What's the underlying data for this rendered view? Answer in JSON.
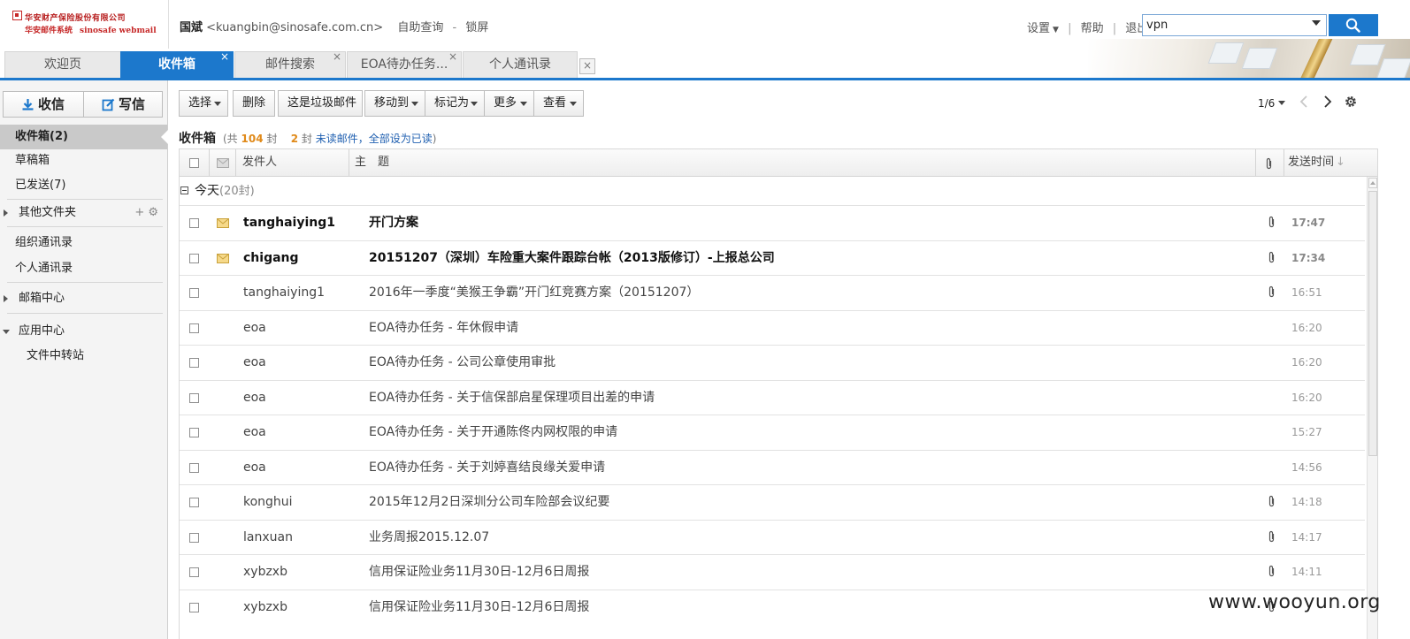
{
  "header": {
    "logo_cn": "华安财产保险股份有限公司",
    "logo_sub_cn": "华安邮件系统",
    "logo_sub_en": "sinosafe webmail",
    "user_name": "国斌",
    "user_email": "<kuangbin@sinosafe.com.cn>",
    "self_query": "自助查询",
    "separator": "-",
    "lock_screen": "锁屏",
    "settings": "设置",
    "help": "帮助",
    "logout": "退出",
    "link_sep": "|",
    "search_value": "vpn"
  },
  "tabs": [
    {
      "label": "欢迎页",
      "closable": false
    },
    {
      "label": "收件箱",
      "closable": true,
      "active": true
    },
    {
      "label": "邮件搜索",
      "closable": true
    },
    {
      "label": "EOA待办任务...",
      "closable": true
    },
    {
      "label": "个人通讯录",
      "closable": false
    }
  ],
  "tab_close_glyph": "×",
  "sidebar": {
    "receive_btn": "收信",
    "compose_btn": "写信",
    "items": [
      {
        "label": "收件箱(2)"
      },
      {
        "label": "草稿箱"
      },
      {
        "label": "已发送(7)"
      },
      {
        "label": "其他文件夹",
        "tools": "+ ⚙"
      },
      {
        "label": "组织通讯录"
      },
      {
        "label": "个人通讯录"
      },
      {
        "label": "邮箱中心"
      },
      {
        "label": "应用中心"
      },
      {
        "label": "文件中转站"
      }
    ]
  },
  "toolbar": {
    "select": "选择",
    "delete": "删除",
    "spam": "这是垃圾邮件",
    "move_to": "移动到",
    "mark_as": "标记为",
    "more": "更多",
    "view": "查看",
    "page_indicator": "1/6"
  },
  "folder": {
    "title": "收件箱",
    "total_prefix": "(共",
    "total_count": "104",
    "total_suffix": "封",
    "unread_count": "2",
    "unread_suffix": "封",
    "unread_link": "未读邮件",
    "mark_all_link": "，全部设为已读",
    "close_paren": ")"
  },
  "table": {
    "col_sender": "发件人",
    "col_subject": "主　题",
    "col_time": "发送时间",
    "sort_arrow": "↓",
    "group_label": "今天",
    "group_count": "(20封)",
    "rows": [
      {
        "sender": "tanghaiying1",
        "subject": "开门方案",
        "time": "17:47",
        "unread": true,
        "attach": true
      },
      {
        "sender": "chigang",
        "subject": "20151207（深圳）车险重大案件跟踪台帐（2013版修订）-上报总公司",
        "time": "17:34",
        "unread": true,
        "attach": true
      },
      {
        "sender": "tanghaiying1",
        "subject": "2016年一季度“美猴王争霸”开门红竞赛方案（20151207）",
        "time": "16:51",
        "unread": false,
        "attach": true
      },
      {
        "sender": "eoa",
        "subject": "EOA待办任务 - 年休假申请",
        "time": "16:20",
        "unread": false,
        "attach": false
      },
      {
        "sender": "eoa",
        "subject": "EOA待办任务 - 公司公章使用审批",
        "time": "16:20",
        "unread": false,
        "attach": false
      },
      {
        "sender": "eoa",
        "subject": "EOA待办任务 - 关于信保部启星保理项目出差的申请",
        "time": "16:20",
        "unread": false,
        "attach": false
      },
      {
        "sender": "eoa",
        "subject": "EOA待办任务 - 关于开通陈佟内网权限的申请",
        "time": "15:27",
        "unread": false,
        "attach": false
      },
      {
        "sender": "eoa",
        "subject": "EOA待办任务 - 关于刘婷喜结良缘关爱申请",
        "time": "14:56",
        "unread": false,
        "attach": false
      },
      {
        "sender": "konghui",
        "subject": "2015年12月2日深圳分公司车险部会议纪要",
        "time": "14:18",
        "unread": false,
        "attach": true
      },
      {
        "sender": "lanxuan",
        "subject": "业务周报2015.12.07",
        "time": "14:17",
        "unread": false,
        "attach": true
      },
      {
        "sender": "xybzxb",
        "subject": "信用保证险业务11月30日-12月6日周报",
        "time": "14:11",
        "unread": false,
        "attach": true
      },
      {
        "sender": "xybzxb",
        "subject": "信用保证险业务11月30日-12月6日周报",
        "time": "",
        "unread": false,
        "attach": true
      }
    ]
  },
  "watermark": "www.wooyun.org",
  "colors": {
    "accent": "#1c78cc",
    "unread_count": "#e08a1a",
    "link": "#1f5fb0"
  }
}
